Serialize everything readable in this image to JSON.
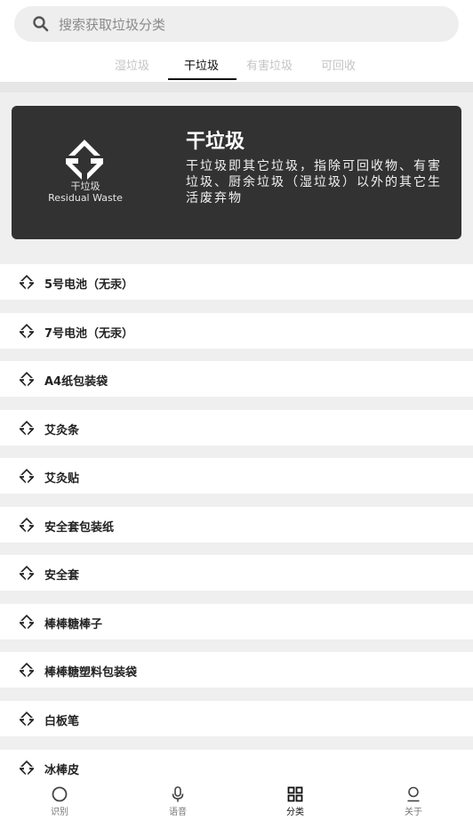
{
  "search": {
    "placeholder": "搜索获取垃圾分类"
  },
  "tabs": [
    {
      "label": "湿垃圾"
    },
    {
      "label": "干垃圾"
    },
    {
      "label": "有害垃圾"
    },
    {
      "label": "可回收"
    }
  ],
  "card": {
    "name_cn": "干垃圾",
    "name_en": "Residual Waste",
    "title": "干垃圾",
    "description": "干垃圾即其它垃圾，指除可回收物、有害垃圾、厨余垃圾（湿垃圾）以外的其它生活废弃物"
  },
  "items": [
    {
      "label": "5号电池（无汞）"
    },
    {
      "label": "7号电池（无汞）"
    },
    {
      "label": "A4纸包装袋"
    },
    {
      "label": "艾灸条"
    },
    {
      "label": "艾灸贴"
    },
    {
      "label": "安全套包装纸"
    },
    {
      "label": "安全套"
    },
    {
      "label": "棒棒糖棒子"
    },
    {
      "label": "棒棒糖塑料包装袋"
    },
    {
      "label": "白板笔"
    },
    {
      "label": "冰棒皮"
    }
  ],
  "bottom_nav": [
    {
      "label": "识别",
      "icon": "circle-icon"
    },
    {
      "label": "语音",
      "icon": "microphone-icon"
    },
    {
      "label": "分类",
      "icon": "grid-icon"
    },
    {
      "label": "关于",
      "icon": "user-icon"
    }
  ],
  "colors": {
    "card_bg": "#323232",
    "active_text": "#111111",
    "inactive_tab": "#c4c4c4"
  }
}
